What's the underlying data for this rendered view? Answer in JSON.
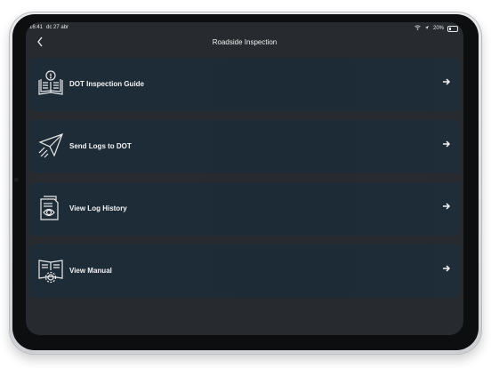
{
  "status": {
    "time": "16:41",
    "date": "dc 27 abr",
    "battery": "20%"
  },
  "nav": {
    "title": "Roadside Inspection",
    "back_icon": "chevron-left-icon"
  },
  "menu": [
    {
      "label": "DOT Inspection Guide",
      "icon": "guide-book-icon"
    },
    {
      "label": "Send Logs to DOT",
      "icon": "paper-plane-icon"
    },
    {
      "label": "View Log History",
      "icon": "document-eye-icon"
    },
    {
      "label": "View Manual",
      "icon": "manual-gear-icon"
    }
  ],
  "colors": {
    "background": "#272a2e",
    "card": "#1e2c38",
    "text": "#f4f4f4"
  }
}
